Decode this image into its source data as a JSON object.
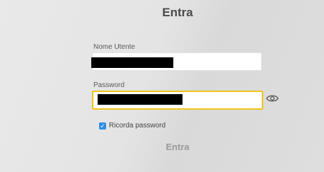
{
  "form": {
    "title": "Entra",
    "username_label": "Nome Utente",
    "password_label": "Password",
    "remember_label": "Ricorda password",
    "remember_checked": true,
    "submit_label": "Entra"
  },
  "colors": {
    "focus_border": "#f0c41b",
    "checkbox": "#2f8ee5",
    "submit_text": "#9a9a9a"
  },
  "icons": {
    "password_toggle": "eye-icon",
    "checkbox": "checkmark-icon"
  }
}
